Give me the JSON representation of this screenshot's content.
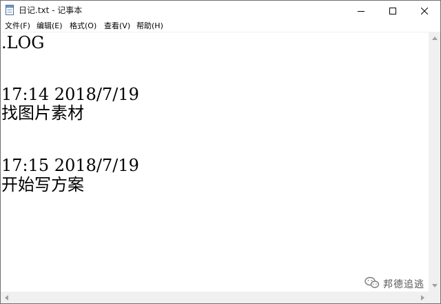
{
  "window": {
    "title": "日记.txt - 记事本"
  },
  "menu": {
    "items": [
      {
        "label": "文件(F)"
      },
      {
        "label": "编辑(E)"
      },
      {
        "label": "格式(O)"
      },
      {
        "label": "查看(V)"
      },
      {
        "label": "帮助(H)"
      }
    ]
  },
  "editor": {
    "lines": [
      ".LOG",
      "17:14 2018/7/19",
      "找图片素材",
      "17:15 2018/7/19",
      "开始写方案"
    ]
  },
  "watermark": {
    "text": "邦德追逃"
  },
  "icons": {
    "app": "notepad-icon",
    "minimize": "minimize-icon",
    "maximize": "maximize-icon",
    "close": "close-icon"
  }
}
